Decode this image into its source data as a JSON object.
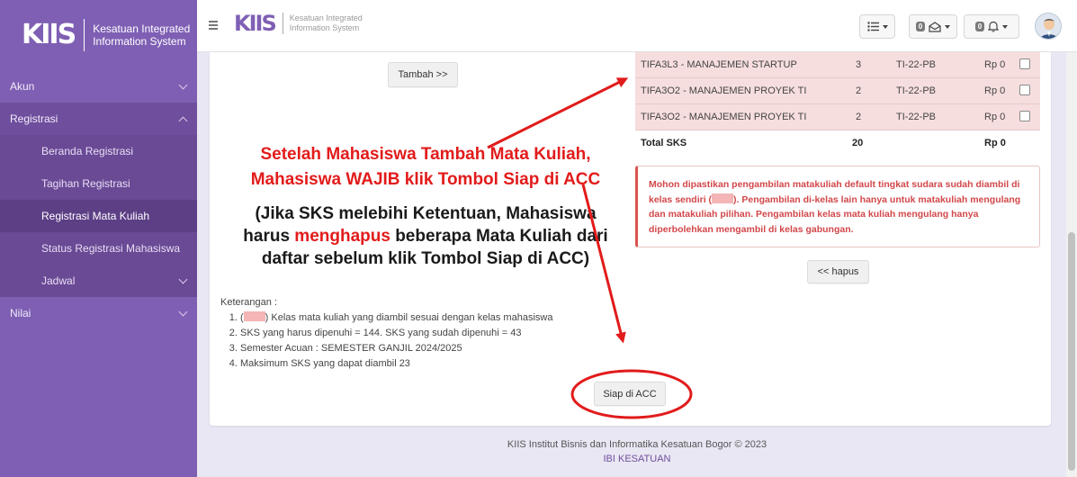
{
  "brand": {
    "logo": "KIIS",
    "line1": "Kesatuan Integrated",
    "line2": "Information System"
  },
  "sidebar": {
    "items": [
      {
        "label": "Akun"
      },
      {
        "label": "Registrasi"
      },
      {
        "label": "Beranda Registrasi"
      },
      {
        "label": "Tagihan Registrasi"
      },
      {
        "label": "Registrasi Mata Kuliah"
      },
      {
        "label": "Status Registrasi Mahasiswa"
      },
      {
        "label": "Jadwal"
      },
      {
        "label": "Nilai"
      }
    ]
  },
  "topbar": {
    "logo": "KIIS",
    "line1": "Kesatuan Integrated",
    "line2": "Information System",
    "mail_count": "0",
    "notif_count": "0"
  },
  "buttons": {
    "tambah": "Tambah >>",
    "hapus": "<< hapus",
    "siap": "Siap di ACC"
  },
  "table": {
    "rows": [
      {
        "course": "TIFA3L3 - MANAJEMEN STARTUP",
        "sks": "3",
        "kelas": "TI-22-PB",
        "biaya": "Rp 0"
      },
      {
        "course": "TIFA3O2 - MANAJEMEN PROYEK TI",
        "sks": "2",
        "kelas": "TI-22-PB",
        "biaya": "Rp 0"
      },
      {
        "course": "TIFA3O2 - MANAJEMEN PROYEK TI",
        "sks": "2",
        "kelas": "TI-22-PB",
        "biaya": "Rp 0"
      }
    ],
    "total": {
      "label": "Total SKS",
      "sks": "20",
      "biaya": "Rp 0"
    }
  },
  "alert": {
    "part1": "Mohon dipastikan pengambilan matakuliah default tingkat sudara sudah diambil di kelas sendiri (",
    "part2": "). Pengambilan di-kelas lain hanya untuk matakuliah mengulang dan matakuliah pilihan. Pengambilan kelas mata kuliah mengulang hanya diperbolehkan mengambil di kelas gabungan."
  },
  "instruction": {
    "line1": "Setelah Mahasiswa Tambah Mata Kuliah,",
    "line2": "Mahasiswa WAJIB klik Tombol Siap di ACC",
    "line3": "(Jika SKS melebihi Ketentuan, Mahasiswa",
    "line4a": "harus ",
    "line4b": "menghapus",
    "line4c": " beberapa Mata Kuliah dari",
    "line5": "daftar sebelum klik Tombol Siap di ACC)"
  },
  "notes": {
    "title": "Keterangan :",
    "item1a": "(",
    "item1b": ") Kelas mata kuliah yang diambil sesuai dengan kelas mahasiswa",
    "item2": "SKS yang harus dipenuhi = 144. SKS yang sudah dipenuhi = 43",
    "item3": "Semester Acuan : SEMESTER GANJIL 2024/2025",
    "item4": "Maksimum SKS yang dapat diambil 23"
  },
  "footer": {
    "line1": "KIIS Institut Bisnis dan Informatika Kesatuan Bogor © 2023",
    "line2": "IBI KESATUAN"
  },
  "colors": {
    "sidebar": "#7f5fb4",
    "accent_red": "#e21b1b",
    "row_pink": "#f7dede"
  }
}
